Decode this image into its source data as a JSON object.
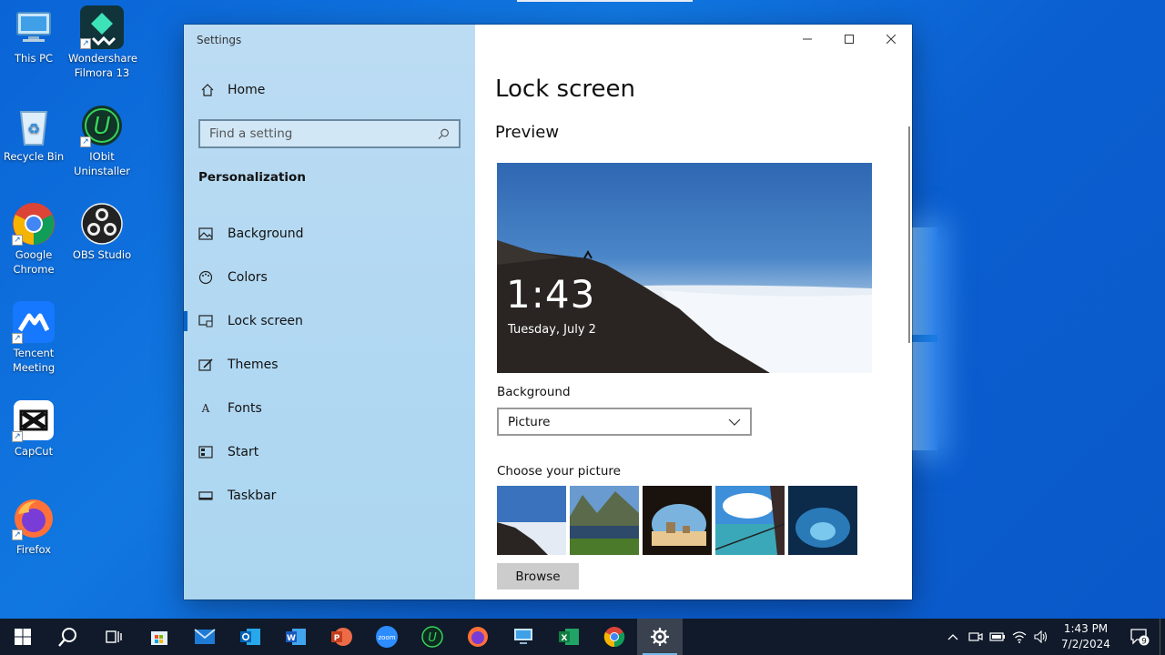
{
  "desktop": {
    "icons": [
      {
        "label": "This PC"
      },
      {
        "label": "Wondershare Filmora 13"
      },
      {
        "label": "Recycle Bin"
      },
      {
        "label": "IObit Uninstaller"
      },
      {
        "label": "Google Chrome"
      },
      {
        "label": "OBS Studio"
      },
      {
        "label": "Tencent Meeting"
      },
      {
        "label": "CapCut"
      },
      {
        "label": "Firefox"
      }
    ]
  },
  "settings": {
    "window_title": "Settings",
    "home_label": "Home",
    "search_placeholder": "Find a setting",
    "section_title": "Personalization",
    "nav": [
      {
        "label": "Background",
        "icon": "picture-icon"
      },
      {
        "label": "Colors",
        "icon": "palette-icon"
      },
      {
        "label": "Lock screen",
        "icon": "lock-screen-icon",
        "active": true
      },
      {
        "label": "Themes",
        "icon": "themes-icon"
      },
      {
        "label": "Fonts",
        "icon": "fonts-icon"
      },
      {
        "label": "Start",
        "icon": "start-icon"
      },
      {
        "label": "Taskbar",
        "icon": "taskbar-icon"
      }
    ],
    "page_title": "Lock screen",
    "preview_heading": "Preview",
    "preview_time": "1:43",
    "preview_date": "Tuesday, July 2",
    "background_label": "Background",
    "background_value": "Picture",
    "choose_label": "Choose your picture",
    "browse_label": "Browse"
  },
  "taskbar": {
    "time": "1:43 PM",
    "date": "7/2/2024",
    "notifications": "9",
    "zoom_label": "zoom"
  },
  "colors": {
    "accent": "#0a64c8",
    "desktop": "#0b66d8",
    "taskbar": "#101a2a"
  }
}
